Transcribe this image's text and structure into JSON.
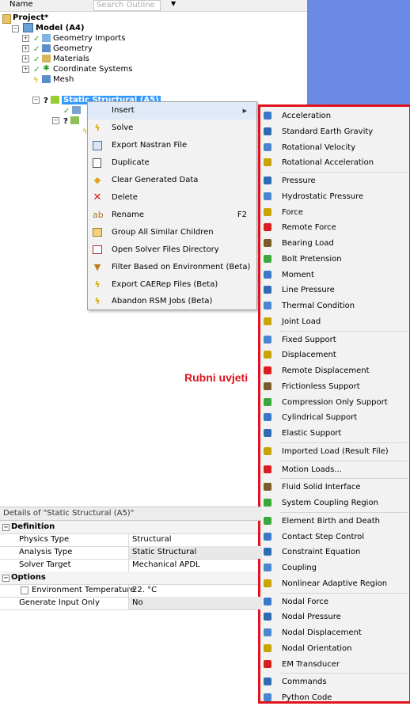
{
  "outline": {
    "name_label": "Name",
    "search_placeholder": "Search Outline",
    "dropdown_glyph": "▼",
    "tree": {
      "project": "Project*",
      "model": "Model (A4)",
      "geometry_imports": "Geometry Imports",
      "geometry": "Geometry",
      "materials": "Materials",
      "coordinate_systems": "Coordinate Systems",
      "mesh": "Mesh",
      "static_structural": "Static Structural (A5)"
    }
  },
  "context_menu": {
    "items": [
      {
        "label": "Insert",
        "icon": "",
        "shortcut": "",
        "has_submenu": true
      },
      {
        "label": "Solve",
        "icon": "lightning-icon",
        "shortcut": ""
      },
      {
        "label": "Export Nastran File",
        "icon": "nastran-icon",
        "shortcut": ""
      },
      {
        "label": "Duplicate",
        "icon": "duplicate-icon",
        "shortcut": ""
      },
      {
        "label": "Clear Generated Data",
        "icon": "eraser-icon",
        "shortcut": ""
      },
      {
        "label": "Delete",
        "icon": "delete-icon",
        "shortcut": ""
      },
      {
        "label": "Rename",
        "icon": "rename-icon",
        "shortcut": "F2"
      },
      {
        "label": "Group All Similar Children",
        "icon": "folder-icon",
        "shortcut": ""
      },
      {
        "label": "Open Solver Files Directory",
        "icon": "folder-open-icon",
        "shortcut": ""
      },
      {
        "label": "Filter Based on Environment (Beta)",
        "icon": "filter-icon",
        "shortcut": ""
      },
      {
        "label": "Export CAERep Files (Beta)",
        "icon": "lightning-icon",
        "shortcut": ""
      },
      {
        "label": "Abandon RSM Jobs (Beta)",
        "icon": "lightning-icon",
        "shortcut": ""
      }
    ],
    "submenu_arrow": "▶"
  },
  "submenu": {
    "groups": [
      [
        "Acceleration",
        "Standard Earth Gravity",
        "Rotational Velocity",
        "Rotational Acceleration"
      ],
      [
        "Pressure",
        "Hydrostatic Pressure",
        "Force",
        "Remote Force",
        "Bearing Load",
        "Bolt Pretension",
        "Moment",
        "Line Pressure",
        "Thermal Condition",
        "Joint Load"
      ],
      [
        "Fixed Support",
        "Displacement",
        "Remote Displacement",
        "Frictionless Support",
        "Compression Only Support",
        "Cylindrical Support",
        "Elastic Support"
      ],
      [
        "Imported Load (Result File)"
      ],
      [
        "Motion Loads..."
      ],
      [
        "Fluid Solid Interface",
        "System Coupling Region"
      ],
      [
        "Element Birth and Death",
        "Contact Step Control",
        "Constraint Equation",
        "Coupling",
        "Nonlinear Adaptive Region"
      ],
      [
        "Nodal Force",
        "Nodal Pressure",
        "Nodal Displacement",
        "Nodal Orientation",
        "EM Transducer"
      ],
      [
        "Commands",
        "Python Code"
      ]
    ]
  },
  "annotation": "Rubni uvjeti",
  "details": {
    "title": "Details of \"Static Structural (A5)\"",
    "groups": [
      {
        "name": "Definition",
        "rows": [
          {
            "label": "Physics Type",
            "value": "Structural"
          },
          {
            "label": "Analysis Type",
            "value": "Static Structural"
          },
          {
            "label": "Solver Target",
            "value": "Mechanical APDL"
          }
        ]
      },
      {
        "name": "Options",
        "rows": [
          {
            "label": "Environment Temperature",
            "value": "22. °C"
          },
          {
            "label": "Generate Input Only",
            "value": "No"
          }
        ]
      }
    ]
  },
  "colors": {
    "accent": "#e0141e",
    "selection": "#3399ff",
    "viewport": "#6b8ae5"
  }
}
